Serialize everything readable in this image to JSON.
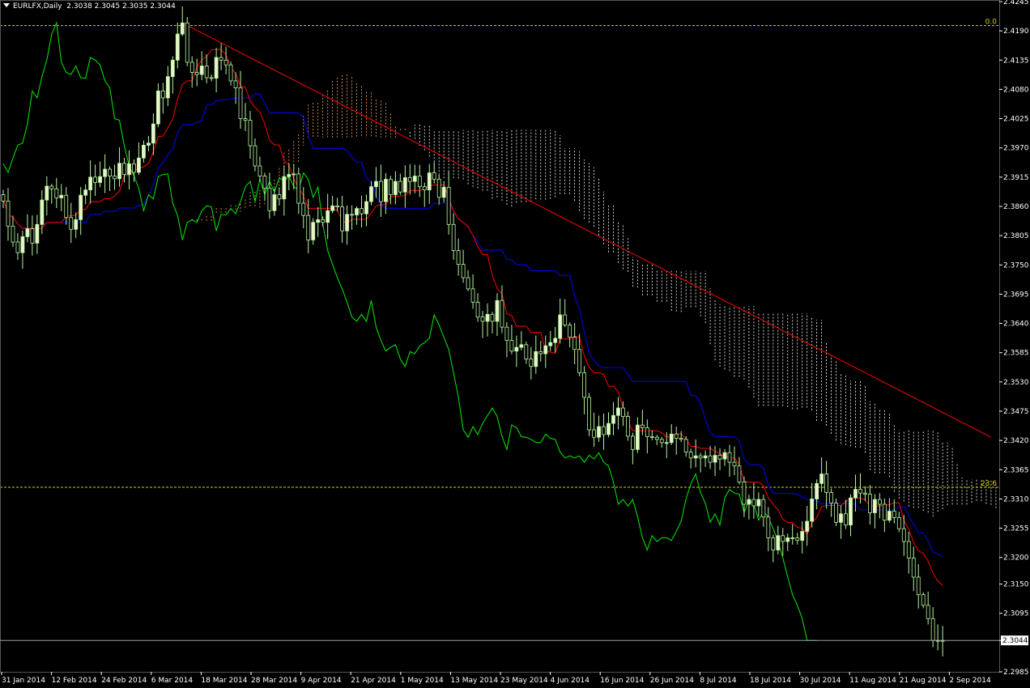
{
  "header": {
    "symbol_timeframe": "EURLFX,Daily",
    "ohlc": "2.3038 2.3045 2.3035 2.3044"
  },
  "colors": {
    "background": "#000000",
    "axis": "#ffffff",
    "candle_bull": "#e8f5c8",
    "candle_bear": "#000000",
    "wick": "#b8f5a0",
    "tenkan": "#ff0000",
    "kijun": "#0000ff",
    "chikou": "#00ee00",
    "trendline": "#ff0000",
    "fib_level": "#d4d400",
    "cloud_bull": "#f5a860",
    "cloud_bear": "#ffffff",
    "price_line": "#9aa0a6"
  },
  "chart_data": {
    "type": "candlestick",
    "y_axis": {
      "min": 2.2985,
      "max": 2.4245,
      "tick_step": 0.0055,
      "tick_labels": [
        "2.4245",
        "2.4190",
        "2.4135",
        "2.4080",
        "2.4025",
        "2.3970",
        "2.3915",
        "2.3860",
        "2.3805",
        "2.3750",
        "2.3695",
        "2.3640",
        "2.3585",
        "2.3530",
        "2.3475",
        "2.3420",
        "2.3365",
        "2.3310",
        "2.3255",
        "2.3200",
        "2.3150",
        "2.3095",
        "2.3044",
        "2.2985"
      ],
      "current_price": "2.3044"
    },
    "x_axis": {
      "tick_labels": [
        "31 Jan 2014",
        "12 Feb 2014",
        "24 Feb 2014",
        "6 Mar 2014",
        "18 Mar 2014",
        "28 Mar 2014",
        "9 Apr 2014",
        "21 Apr 2014",
        "1 May 2014",
        "13 May 2014",
        "23 May 2014",
        "4 Jun 2014",
        "16 Jun 2014",
        "26 Jun 2014",
        "8 Jul 2014",
        "18 Jul 2014",
        "30 Jul 2014",
        "11 Aug 2014",
        "21 Aug 2014",
        "2 Sep 2014"
      ]
    },
    "fibonacci": [
      {
        "label": "0.0",
        "price": 2.42
      },
      {
        "label": "23.6",
        "price": 2.3332
      }
    ],
    "trendline": {
      "from": {
        "bar": 37,
        "price": 2.4205
      },
      "to": {
        "bar": 204,
        "price": 2.3426
      }
    },
    "closes": [
      2.387,
      2.3823,
      2.3793,
      2.3773,
      2.3803,
      2.3818,
      2.3791,
      2.3826,
      2.3872,
      2.3898,
      2.3893,
      2.3876,
      2.3881,
      2.3839,
      2.3817,
      2.3835,
      2.3881,
      2.3891,
      2.3915,
      2.3905,
      2.3916,
      2.393,
      2.3917,
      2.3912,
      2.3941,
      2.392,
      2.394,
      2.3924,
      2.3951,
      2.3975,
      2.3979,
      2.4015,
      2.4077,
      2.4064,
      2.4104,
      2.4135,
      2.4184,
      2.4205,
      2.4131,
      2.4112,
      2.4108,
      2.4124,
      2.4102,
      2.4101,
      2.414,
      2.4135,
      2.4126,
      2.4096,
      2.4083,
      2.4025,
      2.4022,
      2.3974,
      2.3936,
      2.3917,
      2.3894,
      2.3852,
      2.3882,
      2.3874,
      2.3916,
      2.392,
      2.3921,
      2.3866,
      2.3843,
      2.3797,
      2.383,
      2.3835,
      2.383,
      2.3852,
      2.3861,
      2.3859,
      2.3814,
      2.3845,
      2.3844,
      2.3856,
      2.3846,
      2.3869,
      2.3897,
      2.3907,
      2.3869,
      2.3911,
      2.3882,
      2.3907,
      2.3887,
      2.3914,
      2.3907,
      2.3917,
      2.3897,
      2.3891,
      2.3923,
      2.3911,
      2.3877,
      2.3896,
      2.3826,
      2.3777,
      2.3751,
      2.3726,
      2.3705,
      2.368,
      2.3652,
      2.3644,
      2.3657,
      2.3644,
      2.3683,
      2.3633,
      2.3608,
      2.3588,
      2.3595,
      2.36,
      2.3573,
      2.3559,
      2.3587,
      2.3583,
      2.3598,
      2.3604,
      2.3612,
      2.3656,
      2.3637,
      2.3614,
      2.3591,
      2.3547,
      2.3501,
      2.344,
      2.3426,
      2.3446,
      2.3431,
      2.3452,
      2.3467,
      2.3481,
      2.3465,
      2.3428,
      2.3403,
      2.3449,
      2.3444,
      2.3427,
      2.3426,
      2.3422,
      2.3416,
      2.3416,
      2.3432,
      2.3424,
      2.3422,
      2.3398,
      2.3387,
      2.3391,
      2.3387,
      2.3391,
      2.3379,
      2.3392,
      2.3385,
      2.3397,
      2.3379,
      2.3372,
      2.3342,
      2.33,
      2.3309,
      2.3297,
      2.3309,
      2.3276,
      2.3237,
      2.3214,
      2.3241,
      2.323,
      2.3237,
      2.3237,
      2.3232,
      2.3249,
      2.3268,
      2.331,
      2.3339,
      2.3357,
      2.3322,
      2.3302,
      2.3266,
      2.3282,
      2.3261,
      2.3312,
      2.3328,
      2.3321,
      2.3319,
      2.3284,
      2.3309,
      2.33,
      2.327,
      2.3287,
      2.3275,
      2.3254,
      2.323,
      2.3199,
      2.3163,
      2.313,
      2.311,
      2.3085,
      2.3044,
      2.3044,
      2.3044
    ]
  }
}
